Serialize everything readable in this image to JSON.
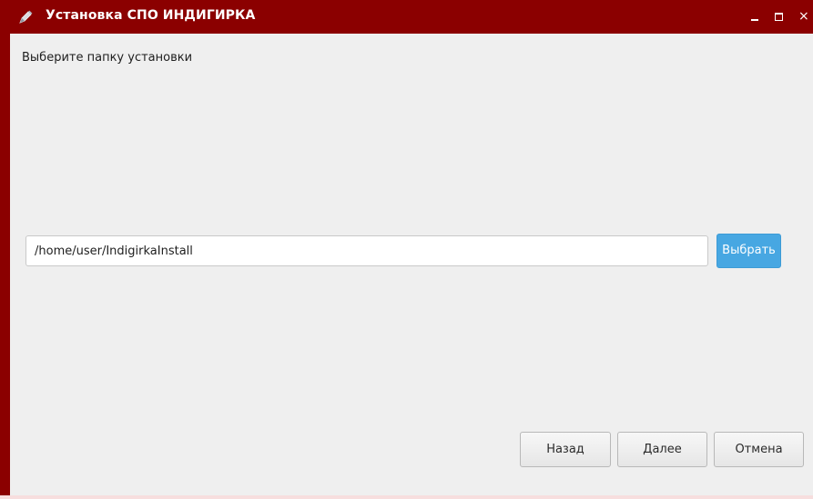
{
  "window": {
    "title": "Установка СПО ИНДИГИРКА",
    "controls": {
      "minimize_label": "_",
      "maximize_label": "□",
      "close_label": "×"
    },
    "colors": {
      "titlebar": "#8b0000",
      "content_background": "#efefef",
      "accent_button": "#47a7e2"
    }
  },
  "page": {
    "heading": "Выберите папку установки",
    "install_path": {
      "value": "/home/user/IndigirkaInstall",
      "placeholder": ""
    },
    "browse_label": "Выбрать"
  },
  "footer": {
    "back_label": "Назад",
    "next_label": "Далее",
    "cancel_label": "Отмена"
  },
  "icons": {
    "app": "pencil-icon"
  }
}
